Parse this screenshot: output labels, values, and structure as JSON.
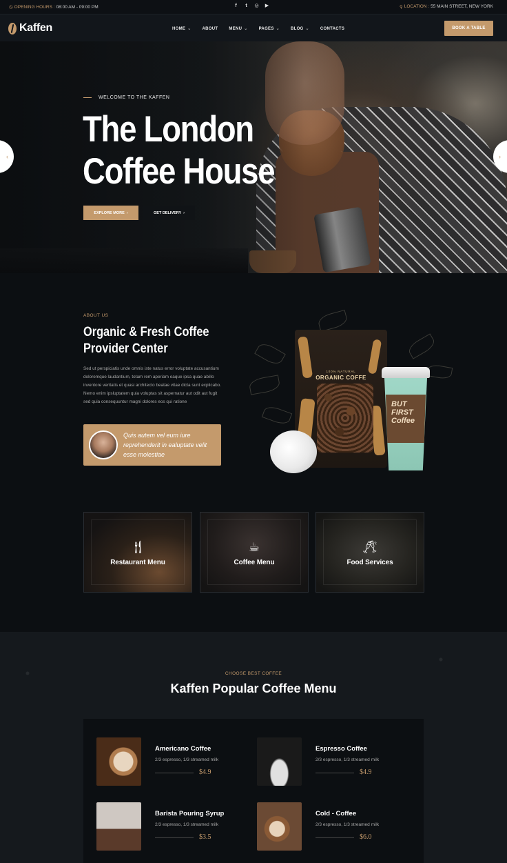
{
  "topbar": {
    "hours_label": "OPENING HOURS :",
    "hours_value": "08:00 AM - 09:00 PM",
    "location_label": "LOCATION :",
    "location_value": "55 MAIN STREET, NEW YORK",
    "social_icons": [
      "facebook-icon",
      "twitter-icon",
      "instagram-icon",
      "youtube-icon"
    ]
  },
  "header": {
    "logo": "Kaffen",
    "nav": [
      {
        "label": "HOME",
        "dropdown": true
      },
      {
        "label": "ABOUT",
        "dropdown": false
      },
      {
        "label": "MENU",
        "dropdown": true
      },
      {
        "label": "PAGES",
        "dropdown": true
      },
      {
        "label": "BLOG",
        "dropdown": true
      },
      {
        "label": "CONTACTS",
        "dropdown": false
      }
    ],
    "cta": "BOOK A TABLE"
  },
  "hero": {
    "welcome": "WELCOME TO THE KAFFEN",
    "title_line1": "The London",
    "title_line2": "Coffee House",
    "btn_explore": "EXPLORE MORE",
    "btn_delivery": "GET DELIVERY"
  },
  "about": {
    "eyebrow": "ABOUT US",
    "heading": "Organic & Fresh Coffee Provider Center",
    "paragraph": "Sed ut perspiciatis unde omnis iste natus error voluptate accusantium doloremque laudantium, totam rem aperiam eaque ipsa quae abillo inventore veritatis et quasi architecto beatae vitae dicta sunt explicabo. Nemo enim ipsluptatem quia voluptas sit aspernatur aut odit aut fugit sed quia consequuntur magni dolores eos qui ratione",
    "quote": "Quis autem vel eum iure reprehenderit in ealuptate velit esse molestiae",
    "bag_label_small": "100% NATURAL",
    "bag_label_big": "ORGANIC COFFE",
    "cup_text": "BUT FIRST Coffee"
  },
  "services": [
    {
      "label": "Restaurant Menu",
      "icon": "fork-knife-icon"
    },
    {
      "label": "Coffee Menu",
      "icon": "coffee-cup-icon"
    },
    {
      "label": "Food Services",
      "icon": "cheers-glasses-icon"
    }
  ],
  "menu": {
    "eyebrow": "CHOOSE BEST COFFEE",
    "heading": "Kaffen Popular Coffee Menu",
    "items": [
      {
        "name": "Americano Coffee",
        "desc": "2/3 espresso, 1/3 streamed milk",
        "price": "$4.9"
      },
      {
        "name": "Espresso Coffee",
        "desc": "2/3 espresso, 1/3 streamed milk",
        "price": "$4.9"
      },
      {
        "name": "Barista Pouring Syrup",
        "desc": "2/3 espresso, 1/3 streamed milk",
        "price": "$3.5"
      },
      {
        "name": "Cold - Coffee",
        "desc": "2/3 espresso, 1/3 streamed milk",
        "price": "$6.0"
      }
    ]
  },
  "colors": {
    "accent": "#c49a6c",
    "background": "#0c0f12",
    "header": "#12161b"
  }
}
